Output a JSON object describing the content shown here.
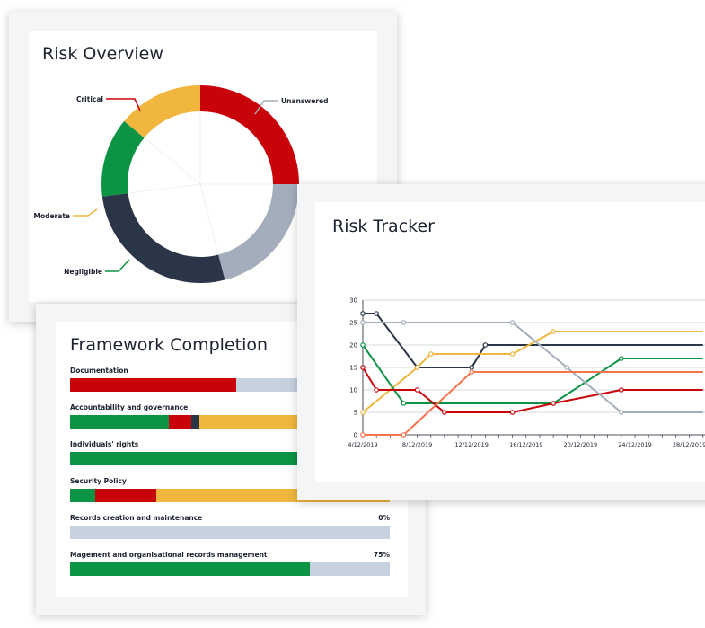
{
  "colors": {
    "critical": "#c8030a",
    "moderate": "#f0b63e",
    "negligible": "#0c9444",
    "high": "#2b3548",
    "unanswered": "#a3adbb",
    "track": "#c6d1df",
    "orange": "#f5744b"
  },
  "risk_overview": {
    "title": "Risk Overview",
    "labels": {
      "critical": "Critical",
      "unanswered": "Unanswered",
      "moderate": "Moderate",
      "negligible": "Negligible"
    }
  },
  "framework": {
    "title": "Framework Completion",
    "rows": [
      {
        "label": "Documentation",
        "pct": "",
        "segments": [
          {
            "color": "critical",
            "value": 52
          },
          {
            "color": "track",
            "value": 48
          }
        ]
      },
      {
        "label": "Accountability and governance",
        "pct": "",
        "segments": [
          {
            "color": "negligible",
            "value": 31
          },
          {
            "color": "critical",
            "value": 7
          },
          {
            "color": "high",
            "value": 2.5
          },
          {
            "color": "moderate",
            "value": 59.5
          }
        ]
      },
      {
        "label": "Individuals' rights",
        "pct": "",
        "segments": [
          {
            "color": "negligible",
            "value": 100
          }
        ]
      },
      {
        "label": "Security Policy",
        "pct": "",
        "segments": [
          {
            "color": "negligible",
            "value": 8
          },
          {
            "color": "critical",
            "value": 19
          },
          {
            "color": "moderate",
            "value": 73
          }
        ]
      },
      {
        "label": "Records creation and maintenance",
        "pct": "0%",
        "segments": []
      },
      {
        "label": "Magement and organisational records management",
        "pct": "75%",
        "segments": [
          {
            "color": "negligible",
            "value": 75
          }
        ]
      }
    ]
  },
  "chart_data": [
    {
      "type": "pie",
      "title": "Risk Overview",
      "categories": [
        "Critical",
        "Unanswered",
        "",
        "Negligible",
        "Moderate"
      ],
      "values": [
        25,
        21,
        27,
        13,
        14
      ],
      "colors": [
        "critical",
        "unanswered",
        "high",
        "negligible",
        "moderate"
      ]
    },
    {
      "type": "line",
      "title": "Risk Tracker",
      "x": [
        "4/12/2019",
        "5/12/2019",
        "6/12/2019",
        "7/12/2019",
        "8/12/2019",
        "9/12/2019",
        "10/12/2019",
        "11/12/2019",
        "12/12/2019",
        "13/12/2019",
        "14/12/2019",
        "15/12/2019",
        "16/12/2019",
        "17/12/2019",
        "18/12/2019",
        "19/12/2019",
        "20/12/2019",
        "21/12/2019",
        "22/12/2019",
        "23/12/2019",
        "24/12/2019",
        "25/12/2019",
        "26/12/2019",
        "27/12/2019",
        "28/12/2019",
        "29/12/2019"
      ],
      "xticks": [
        "4/12/2019",
        "8/12/2019",
        "12/12/2019",
        "16/12/2019",
        "20/12/2019",
        "24/12/2019",
        "28/12/2019"
      ],
      "yticks": [
        0,
        5,
        10,
        15,
        20,
        25,
        30
      ],
      "ylim": [
        0,
        30
      ],
      "grid": true,
      "series": [
        {
          "color": "high",
          "points": [
            [
              "4/12/2019",
              27
            ],
            [
              "5/12/2019",
              27
            ],
            [
              "8/12/2019",
              15
            ],
            [
              "12/12/2019",
              15
            ],
            [
              "13/12/2019",
              20
            ],
            [
              "29/12/2019",
              20
            ]
          ]
        },
        {
          "color": "moderate",
          "points": [
            [
              "4/12/2019",
              5
            ],
            [
              "8/12/2019",
              15
            ],
            [
              "9/12/2019",
              18
            ],
            [
              "15/12/2019",
              18
            ],
            [
              "18/12/2019",
              23
            ],
            [
              "29/12/2019",
              23
            ]
          ]
        },
        {
          "color": "negligible",
          "points": [
            [
              "4/12/2019",
              20
            ],
            [
              "7/12/2019",
              7
            ],
            [
              "18/12/2019",
              7
            ],
            [
              "23/12/2019",
              17
            ],
            [
              "29/12/2019",
              17
            ]
          ]
        },
        {
          "color": "critical",
          "points": [
            [
              "4/12/2019",
              15
            ],
            [
              "5/12/2019",
              10
            ],
            [
              "8/12/2019",
              10
            ],
            [
              "10/12/2019",
              5
            ],
            [
              "15/12/2019",
              5
            ],
            [
              "18/12/2019",
              7
            ],
            [
              "23/12/2019",
              10
            ],
            [
              "29/12/2019",
              10
            ]
          ]
        },
        {
          "color": "unanswered",
          "points": [
            [
              "4/12/2019",
              25
            ],
            [
              "7/12/2019",
              25
            ],
            [
              "15/12/2019",
              25
            ],
            [
              "19/12/2019",
              15
            ],
            [
              "23/12/2019",
              5
            ],
            [
              "29/12/2019",
              5
            ]
          ]
        },
        {
          "color": "orange",
          "points": [
            [
              "4/12/2019",
              0
            ],
            [
              "7/12/2019",
              0
            ],
            [
              "12/12/2019",
              14
            ],
            [
              "29/12/2019",
              14
            ]
          ]
        }
      ]
    }
  ],
  "tracker": {
    "title": "Risk Tracker"
  }
}
